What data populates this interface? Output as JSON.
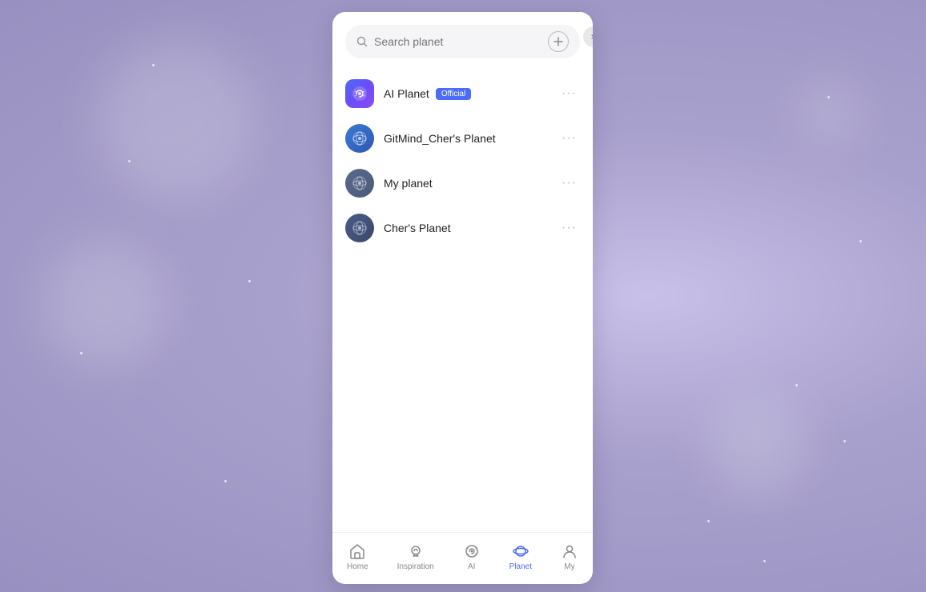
{
  "background": {
    "color": "#b8b0d8"
  },
  "panel": {
    "close_label": "×",
    "search": {
      "placeholder": "Search planet"
    },
    "add_button_label": "+",
    "planets": [
      {
        "id": "ai-planet",
        "name": "AI Planet",
        "badge": "Official",
        "avatar_type": "ai",
        "more_label": "···"
      },
      {
        "id": "gitmind-planet",
        "name": "GitMind_Cher's Planet",
        "badge": null,
        "avatar_type": "gitmind",
        "more_label": "···"
      },
      {
        "id": "my-planet",
        "name": "My planet",
        "badge": null,
        "avatar_type": "myplanet",
        "more_label": "···"
      },
      {
        "id": "chers-planet",
        "name": "Cher's Planet",
        "badge": null,
        "avatar_type": "chers",
        "more_label": "···"
      }
    ],
    "nav": {
      "items": [
        {
          "id": "home",
          "label": "Home",
          "active": false
        },
        {
          "id": "inspiration",
          "label": "Inspiration",
          "active": false
        },
        {
          "id": "ai",
          "label": "AI",
          "active": false
        },
        {
          "id": "planet",
          "label": "Planet",
          "active": true
        },
        {
          "id": "my",
          "label": "My",
          "active": false
        }
      ]
    }
  }
}
